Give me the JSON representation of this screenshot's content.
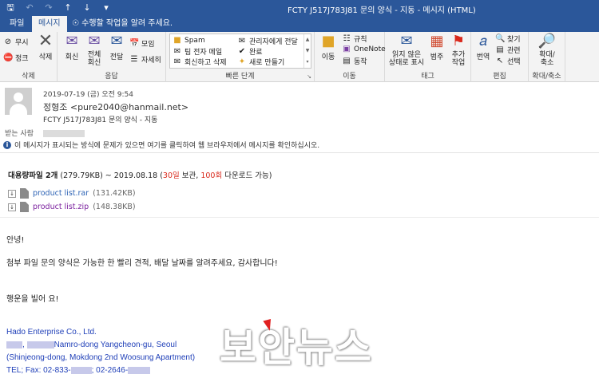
{
  "window": {
    "title": "FCTY J517J783J81 문의 양식 - 지동 - 메시지 (HTML)",
    "qat_icons": [
      "save-icon",
      "undo-icon",
      "redo-icon",
      "up-arrow-icon",
      "down-arrow-icon",
      "customize-icon"
    ]
  },
  "tabs": {
    "file": "파일",
    "message": "메시지",
    "tellme": "수행할 작업을 알려 주세요."
  },
  "ribbon": {
    "delete_group": {
      "ignore": "무시",
      "junk": "정크",
      "delete": "삭제",
      "label": "삭제"
    },
    "respond_group": {
      "reply": "회신",
      "reply_all_1": "전체",
      "reply_all_2": "회신",
      "forward": "전달",
      "meeting": "모임",
      "more": "자세히",
      "label": "응답"
    },
    "quick_steps": {
      "items": [
        "Spam",
        "관리자에게 전달",
        "팀 전자 메일",
        "완료",
        "회신하고 삭제",
        "새로 만들기"
      ],
      "label": "빠른 단계"
    },
    "move_group": {
      "move": "이동",
      "rules": "규칙",
      "onenote": "OneNote",
      "actions": "동작",
      "label": "이동"
    },
    "tags_group": {
      "unread_1": "읽지 않은",
      "unread_2": "상태로 표시",
      "categorize": "범주",
      "followup_1": "추가",
      "followup_2": "작업",
      "label": "태그"
    },
    "edit_group": {
      "translate": "번역",
      "find": "찾기",
      "related": "관련",
      "select": "선택",
      "label": "편집"
    },
    "zoom_group": {
      "zoom_1": "확대/",
      "zoom_2": "축소",
      "label": "확대/축소"
    }
  },
  "header": {
    "date": "2019-07-19 (금) 오전 9:54",
    "from": "정형조 <pure2040@hanmail.net>",
    "subject": "FCTY J517J783J81 문의 양식 - 지동",
    "to_label": "받는 사람",
    "info": "이 메시지가 표시되는 방식에 문제가 있으면 여기를 클릭하여 웹 브라우저에서 메시지를 확인하십시오."
  },
  "attachments": {
    "title_bold": "대용량파일 2개",
    "title_size": "(279.79KB) ~ 2019.08.18 (",
    "days": "30일",
    "keep": "보관, ",
    "count": "100회",
    "download": "다운로드 가능)",
    "files": [
      {
        "name": "product list.rar",
        "size": "(131.42KB)"
      },
      {
        "name": "product list.zip",
        "size": "(148.38KB)"
      }
    ]
  },
  "body": {
    "greeting": "안녕!",
    "line1": "첨부 파일 문의 양식은 가능한 한 빨리 견적, 배달 날짜를 알려주세요, 감사합니다!",
    "closing": "행운을 빌어 요!"
  },
  "signature": {
    "company": "Hado Enterprise Co., Ltd.",
    "addr1_sep": ", ",
    "addr1": "Namro-dong Yangcheon-gu, Seoul",
    "addr2": "(Shinjeong-dong, Mokdong 2nd Woosung Apartment)",
    "tel_prefix": "TEL; Fax: 02-833-",
    "tel_mid": "; 02-2646-"
  },
  "watermark": "보안뉴스",
  "colors": {
    "brand": "#2b579a",
    "link": "#2d63b5",
    "visited": "#7a1f9e",
    "accent_red": "#d9291c",
    "signature_blue": "#1f3fb8"
  }
}
